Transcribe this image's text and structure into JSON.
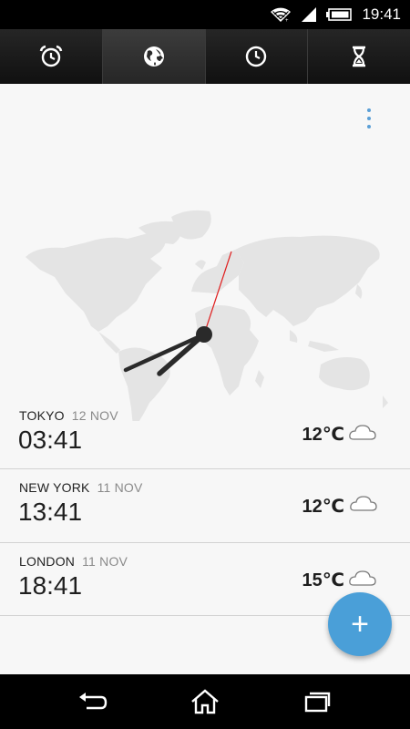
{
  "status_bar": {
    "time": "19:41",
    "icons": [
      "wifi-icon",
      "signal-icon",
      "battery-icon"
    ]
  },
  "tabs": [
    {
      "icon": "alarm-clock-icon",
      "active": false
    },
    {
      "icon": "globe-icon",
      "active": true
    },
    {
      "icon": "clock-icon",
      "active": false
    },
    {
      "icon": "hourglass-icon",
      "active": false
    }
  ],
  "overflow_menu": {
    "icon": "more-vertical-icon"
  },
  "cities": [
    {
      "name": "TOKYO",
      "date": "12 NOV",
      "time": "03:41",
      "temp": "12℃",
      "weather": "partly-cloudy-night-icon"
    },
    {
      "name": "NEW YORK",
      "date": "11 NOV",
      "time": "13:41",
      "temp": "12℃",
      "weather": "cloud-icon"
    },
    {
      "name": "LONDON",
      "date": "11 NOV",
      "time": "18:41",
      "temp": "15℃",
      "weather": "partly-cloudy-night-icon"
    }
  ],
  "fab": {
    "label": "+"
  },
  "nav_bar": {
    "icons": [
      "back-icon",
      "home-icon",
      "recent-apps-icon"
    ]
  },
  "colors": {
    "accent": "#4a9fd8",
    "second_hand": "#e02020",
    "map": "#e4e4e4"
  }
}
